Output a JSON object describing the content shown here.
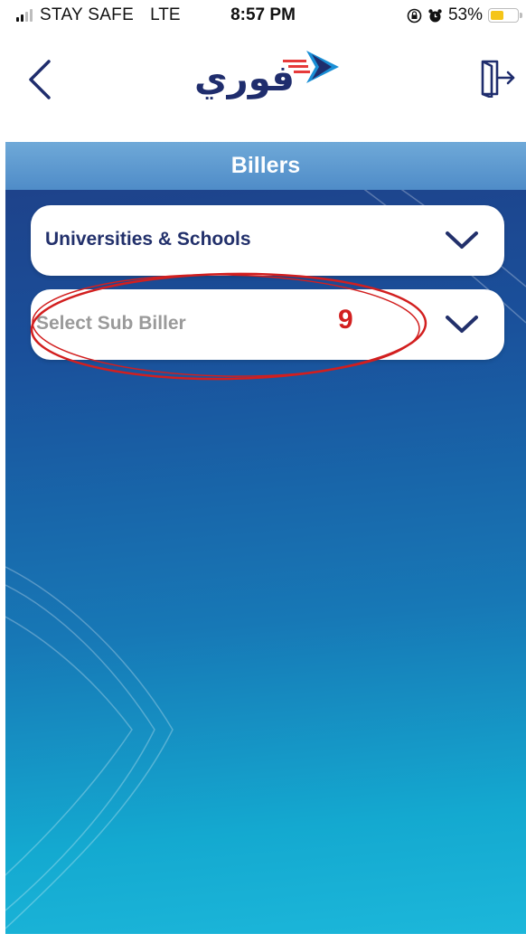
{
  "status_bar": {
    "carrier": "STAY SAFE",
    "network": "LTE",
    "time": "8:57 PM",
    "battery_percent": "53%",
    "battery_level": 0.53,
    "icons": [
      "signal-icon",
      "lock-rotation-icon",
      "alarm-icon",
      "battery-icon"
    ]
  },
  "header": {
    "logo_text": "فوري",
    "icons": [
      "back-arrow-icon",
      "logout-icon"
    ]
  },
  "page": {
    "title": "Billers"
  },
  "biller_dropdown": {
    "value": "Universities & Schools"
  },
  "sub_biller_dropdown": {
    "placeholder": "Select Sub Biller"
  },
  "annotation": {
    "number": "9",
    "color": "#d21f1f"
  },
  "colors": {
    "brand_navy": "#22306b",
    "title_bar": "#4f8cc8",
    "gradient_top": "#1f3f86",
    "gradient_bottom": "#1cb7da"
  }
}
